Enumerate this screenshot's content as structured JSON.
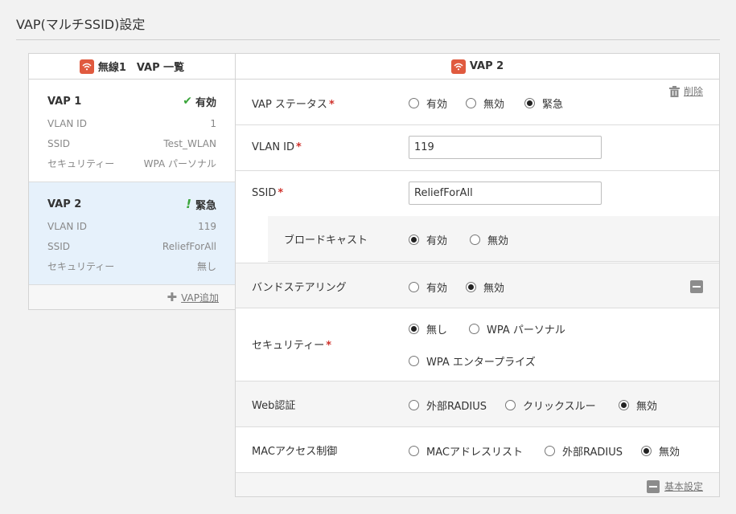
{
  "page": {
    "title": "VAP(マルチSSID)設定"
  },
  "left_panel": {
    "header": "無線1　VAP 一覧",
    "vaps": [
      {
        "name": "VAP 1",
        "status": "有効",
        "rows": [
          {
            "label": "VLAN ID",
            "value": "1"
          },
          {
            "label": "SSID",
            "value": "Test_WLAN"
          },
          {
            "label": "セキュリティー",
            "value": "WPA パーソナル"
          }
        ]
      },
      {
        "name": "VAP 2",
        "status": "緊急",
        "rows": [
          {
            "label": "VLAN ID",
            "value": "119"
          },
          {
            "label": "SSID",
            "value": "ReliefForAll"
          },
          {
            "label": "セキュリティー",
            "value": "無し"
          }
        ]
      }
    ],
    "add_label": "VAP追加"
  },
  "right_panel": {
    "header": "VAP 2",
    "delete_label": "削除",
    "fields": {
      "vap_status": {
        "label": "VAP ステータス",
        "required": "*",
        "options": [
          "有効",
          "無効",
          "緊急"
        ],
        "selected": "緊急"
      },
      "vlan_id": {
        "label": "VLAN ID",
        "required": "*",
        "value": "119"
      },
      "ssid": {
        "label": "SSID",
        "required": "*",
        "value": "ReliefForAll"
      },
      "broadcast": {
        "label": "ブロードキャスト",
        "options": [
          "有効",
          "無効"
        ],
        "selected": "有効"
      },
      "band_steering": {
        "label": "バンドステアリング",
        "options": [
          "有効",
          "無効"
        ],
        "selected": "無効"
      },
      "security": {
        "label": "セキュリティー",
        "required": "*",
        "options": [
          "無し",
          "WPA パーソナル",
          "WPA エンタープライズ"
        ],
        "selected": "無し"
      },
      "web_auth": {
        "label": "Web認証",
        "options": [
          "外部RADIUS",
          "クリックスルー",
          "無効"
        ],
        "selected": "無効"
      },
      "mac_access": {
        "label": "MACアクセス制御",
        "options": [
          "MACアドレスリスト",
          "外部RADIUS",
          "無効"
        ],
        "selected": "無効"
      }
    },
    "basic_settings_label": "基本設定"
  },
  "colors": {
    "wifi_badge": "#e05a3f",
    "required_mark": "#d0322c",
    "status_green": "#3aa53a",
    "selected_card": "#e6f1fb"
  }
}
